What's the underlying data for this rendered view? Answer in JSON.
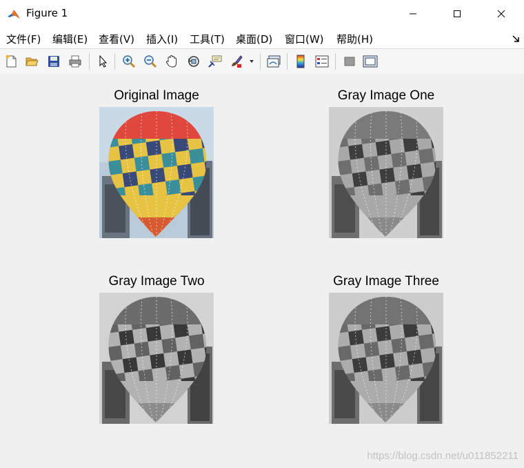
{
  "window": {
    "title": "Figure 1"
  },
  "menu": [
    "文件(F)",
    "编辑(E)",
    "查看(V)",
    "插入(I)",
    "工具(T)",
    "桌面(D)",
    "窗口(W)",
    "帮助(H)"
  ],
  "toolbar_icons": [
    "new-figure-icon",
    "open-file-icon",
    "save-icon",
    "print-icon",
    "select-arrow-icon",
    "zoom-in-icon",
    "zoom-out-icon",
    "pan-hand-icon",
    "rotate-3d-icon",
    "data-cursor-icon",
    "brush-icon",
    "brush-dropdown-icon",
    "link-plot-icon",
    "colorbar-icon",
    "legend-icon",
    "hide-plot-tools-icon",
    "show-plot-tools-icon"
  ],
  "axes": [
    {
      "title": "Original Image",
      "mode": "color"
    },
    {
      "title": "Gray Image One",
      "mode": "gray"
    },
    {
      "title": "Gray Image Two",
      "mode": "gray"
    },
    {
      "title": "Gray Image Three",
      "mode": "gray"
    }
  ],
  "watermark": "https://blog.csdn.net/u011852211",
  "colors": {
    "balloon_red": "#e0483e",
    "balloon_yellow": "#e6c342",
    "balloon_teal": "#3a8f9a",
    "balloon_navy": "#3a4a78",
    "sky": "#b9cbd8"
  }
}
